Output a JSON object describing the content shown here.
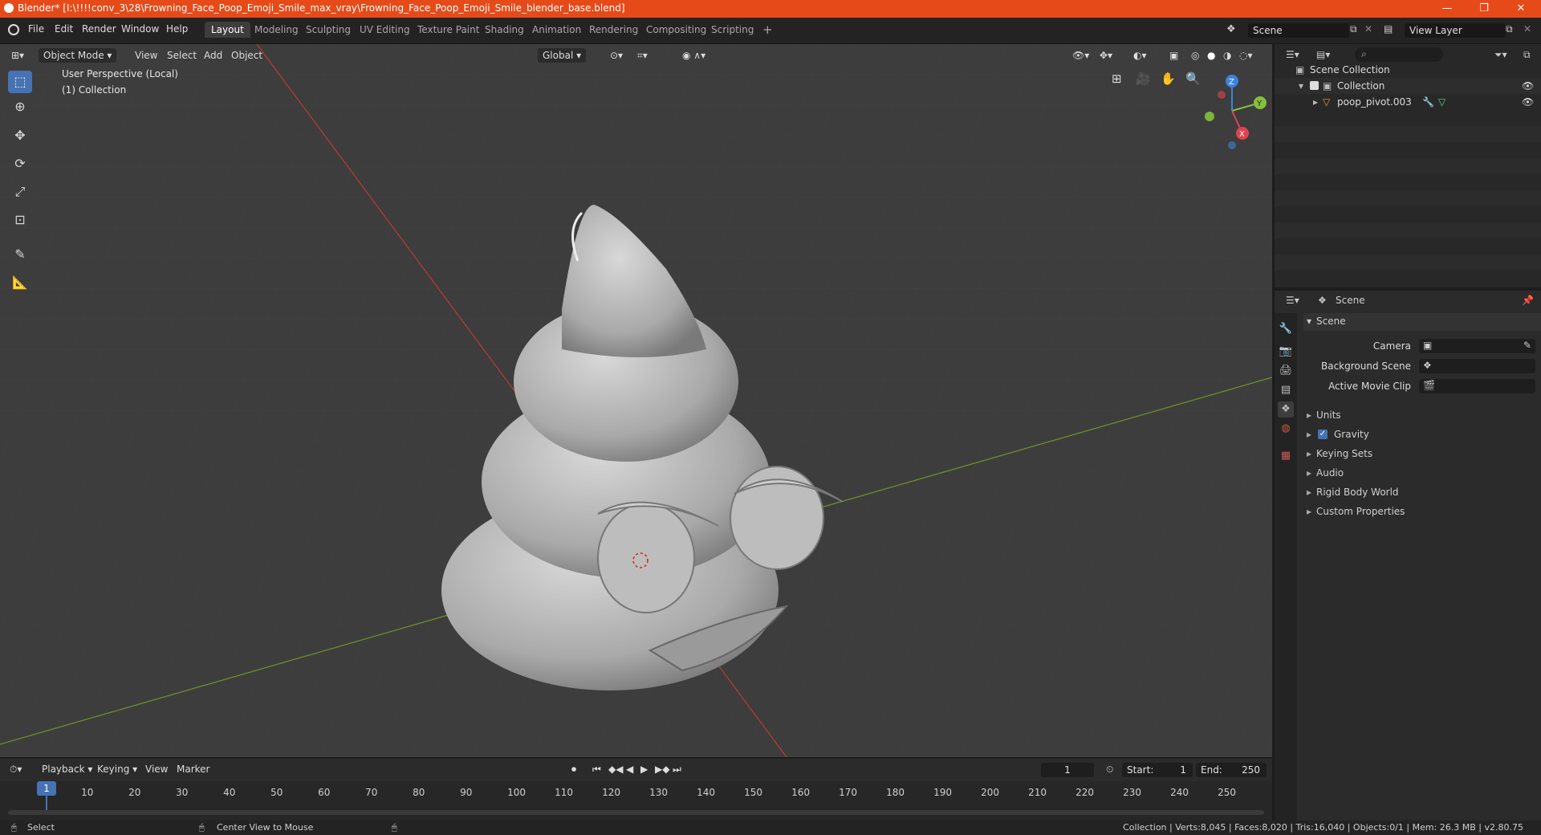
{
  "titlebar": {
    "title": "Blender* [I:\\!!!!conv_3\\28\\Frowning_Face_Poop_Emoji_Smile_max_vray\\Frowning_Face_Poop_Emoji_Smile_blender_base.blend]",
    "minimize": "—",
    "maximize": "❐",
    "close": "✕"
  },
  "menu": {
    "file": "File",
    "edit": "Edit",
    "render": "Render",
    "window": "Window",
    "help": "Help"
  },
  "workspaces": [
    "Layout",
    "Modeling",
    "Sculpting",
    "UV Editing",
    "Texture Paint",
    "Shading",
    "Animation",
    "Rendering",
    "Compositing",
    "Scripting"
  ],
  "workspace_add": "+",
  "scene_field": "Scene",
  "view_layer_field": "View Layer",
  "viewport": {
    "mode": "Object Mode",
    "menus": [
      "View",
      "Select",
      "Add",
      "Object"
    ],
    "orientation": "Global",
    "info_line1": "User Perspective (Local)",
    "info_line2": "(1) Collection",
    "gizmo": {
      "z": "Z",
      "y": "Y",
      "x": "X"
    }
  },
  "outliner": {
    "search_placeholder": "",
    "scene_collection": "Scene Collection",
    "collection": "Collection",
    "object": "poop_pivot.003"
  },
  "properties": {
    "header": "Scene",
    "panel_scene": "Scene",
    "camera_label": "Camera",
    "background_scene_label": "Background Scene",
    "active_movie_clip_label": "Active Movie Clip",
    "panels": [
      "Units",
      "Gravity",
      "Keying Sets",
      "Audio",
      "Rigid Body World",
      "Custom Properties"
    ],
    "gravity_checked": true
  },
  "timeline": {
    "menus": [
      "Playback",
      "Keying",
      "View",
      "Marker"
    ],
    "current_frame": "1",
    "start_label": "Start:",
    "start_value": "1",
    "end_label": "End:",
    "end_value": "250",
    "ticks": [
      "1",
      "10",
      "20",
      "30",
      "40",
      "50",
      "60",
      "70",
      "80",
      "90",
      "100",
      "110",
      "120",
      "130",
      "140",
      "150",
      "160",
      "170",
      "180",
      "190",
      "200",
      "210",
      "220",
      "230",
      "240",
      "250"
    ]
  },
  "statusbar": {
    "select": "Select",
    "center_view": "Center View to Mouse",
    "stats": "Collection | Verts:8,045 | Faces:8,020 | Tris:16,040 | Objects:0/1 | Mem: 26.3 MB | v2.80.75"
  },
  "colors": {
    "titlebar": "#e64a19",
    "accent": "#4772b3",
    "x_axis": "#e0434e",
    "y_axis": "#85c03c",
    "z_axis": "#3b82e0"
  }
}
